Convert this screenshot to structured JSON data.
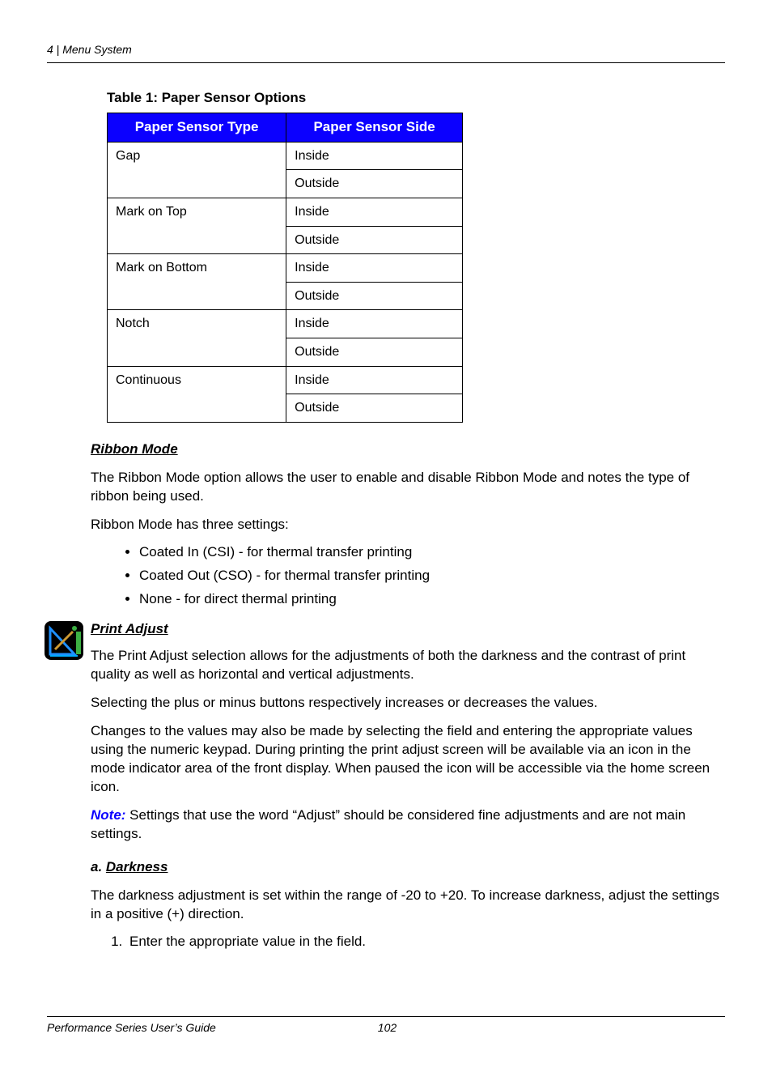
{
  "header": {
    "chapter_num": "4",
    "chapter_sep": "  |  ",
    "chapter_title": "Menu System"
  },
  "table": {
    "caption": "Table 1: Paper Sensor Options",
    "h1": "Paper Sensor Type",
    "h2": "Paper Sensor Side",
    "rows": [
      {
        "type": "Gap",
        "s1": "Inside",
        "s2": "Outside"
      },
      {
        "type": "Mark on Top",
        "s1": "Inside",
        "s2": "Outside"
      },
      {
        "type": "Mark on Bottom",
        "s1": "Inside",
        "s2": "Outside"
      },
      {
        "type": "Notch",
        "s1": "Inside",
        "s2": "Outside"
      },
      {
        "type": "Continuous",
        "s1": "Inside",
        "s2": "Outside"
      }
    ]
  },
  "ribbon": {
    "heading": "Ribbon Mode",
    "p1": "The Ribbon Mode option allows the user to enable and disable Ribbon Mode and notes the type of ribbon being used.",
    "p2": "Ribbon Mode has three settings:",
    "items": [
      "Coated In (CSI) - for thermal transfer printing",
      "Coated Out (CSO) - for thermal transfer printing",
      "None - for direct thermal printing"
    ]
  },
  "padjust": {
    "heading": "Print Adjust",
    "p1": "The Print Adjust selection allows for the adjustments of both the darkness and the contrast of print quality as well as horizontal and vertical adjustments.",
    "p2": "Selecting the plus or minus buttons respectively increases or decreases the values.",
    "p3": "Changes to the values may also be made by selecting the field and entering the appropriate values using the numeric keypad. During printing the print adjust screen will be available via an icon in the mode indicator area of the front display. When paused the icon will be accessible via the home screen icon.",
    "note_label": "Note:",
    "note_text": "  Settings that use the word “Adjust” should be considered fine adjustments and are not main settings."
  },
  "darkness": {
    "prefix": "a. ",
    "heading": "Darkness",
    "p1": "The darkness adjustment is set within the range of -20 to +20. To increase darkness, adjust the settings in a positive (+) direction.",
    "step1": "Enter the appropriate value in the field."
  },
  "footer": {
    "title": "Performance Series User’s Guide",
    "page": "102"
  }
}
